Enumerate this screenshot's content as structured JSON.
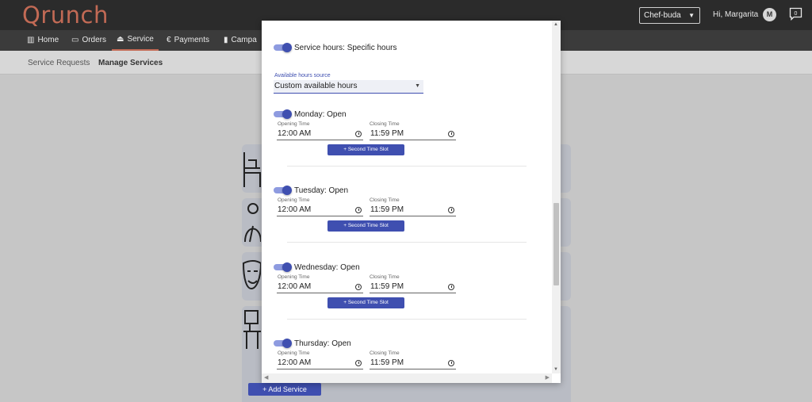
{
  "app": {
    "logo": "Qrunch",
    "restaurant": "Chef-buda",
    "greeting": "Hi, Margarita",
    "avatar_initial": "M",
    "chat_count": "0"
  },
  "nav": [
    {
      "icon": "book-icon",
      "glyph": "▥",
      "label": "Home"
    },
    {
      "icon": "card-icon",
      "glyph": "▭",
      "label": "Orders"
    },
    {
      "icon": "service-bell-icon",
      "glyph": "⏏",
      "label": "Service"
    },
    {
      "icon": "euro-icon",
      "glyph": "€",
      "label": "Payments"
    },
    {
      "icon": "chart-icon",
      "glyph": "▮",
      "label": "Campa"
    }
  ],
  "subnav": {
    "requests": "Service Requests",
    "manage": "Manage Services"
  },
  "add_service": "+ Add Service",
  "modal": {
    "service_hours_label": "Service hours:",
    "service_hours_value": " Specific hours",
    "source_label": "Available hours source",
    "source_value": "Custom available hours",
    "opening_label": "Opening Time",
    "closing_label": "Closing Time",
    "slot_button": "+   Second Time Slot",
    "days": [
      {
        "name": "Monday:",
        "status": " Open",
        "open": "12:00 AM",
        "close": "11:59 PM"
      },
      {
        "name": "Tuesday:",
        "status": " Open",
        "open": "12:00 AM",
        "close": "11:59 PM"
      },
      {
        "name": "Wednesday:",
        "status": " Open",
        "open": "12:00 AM",
        "close": "11:59 PM"
      },
      {
        "name": "Thursday:",
        "status": " Open",
        "open": "12:00 AM",
        "close": "11:59 PM"
      }
    ]
  },
  "colors": {
    "brand": "#c26a55",
    "primary": "#3f4fb0",
    "topbar": "#2b2b2b"
  }
}
